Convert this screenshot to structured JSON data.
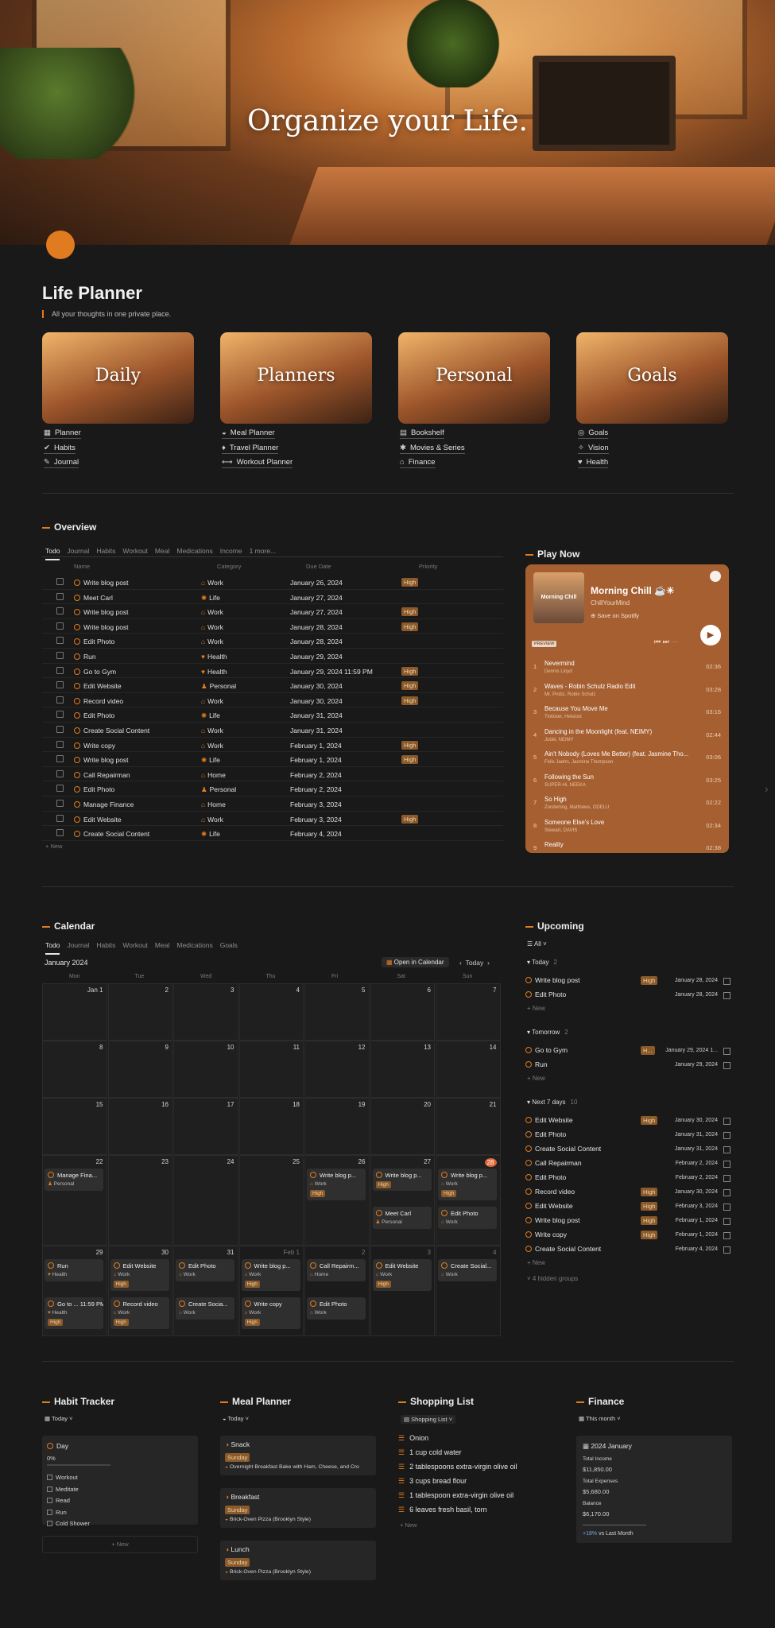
{
  "hero": {
    "title": "Organize your Life."
  },
  "page": {
    "title": "Life Planner",
    "quote": "All your thoughts in one private place."
  },
  "cards": [
    {
      "label": "Daily",
      "links": [
        {
          "icon": "calendar-icon",
          "glyph": "▦",
          "label": "Planner"
        },
        {
          "icon": "check-circle-icon",
          "glyph": "✔",
          "label": "Habits"
        },
        {
          "icon": "pen-icon",
          "glyph": "✎",
          "label": "Journal"
        }
      ]
    },
    {
      "label": "Planners",
      "links": [
        {
          "icon": "bowl-icon",
          "glyph": "◒",
          "label": "Meal Planner"
        },
        {
          "icon": "pin-icon",
          "glyph": "♦",
          "label": "Travel Planner"
        },
        {
          "icon": "dumbbell-icon",
          "glyph": "⟷",
          "label": "Workout Planner"
        }
      ]
    },
    {
      "label": "Personal",
      "links": [
        {
          "icon": "book-icon",
          "glyph": "▤",
          "label": "Bookshelf"
        },
        {
          "icon": "film-icon",
          "glyph": "✱",
          "label": "Movies & Series"
        },
        {
          "icon": "bank-icon",
          "glyph": "⌂",
          "label": "Finance"
        }
      ]
    },
    {
      "label": "Goals",
      "links": [
        {
          "icon": "target-icon",
          "glyph": "◎",
          "label": "Goals"
        },
        {
          "icon": "sparkle-icon",
          "glyph": "✧",
          "label": "Vision"
        },
        {
          "icon": "heart-icon",
          "glyph": "♥",
          "label": "Health"
        }
      ]
    }
  ],
  "overview": {
    "title": "Overview",
    "tabs": [
      "Todo",
      "Journal",
      "Habits",
      "Workout",
      "Meal",
      "Medications",
      "Income",
      "1 more..."
    ],
    "columns": [
      "Name",
      "Category",
      "Due Date",
      "Priority"
    ],
    "rows": [
      {
        "name": "Write blog post",
        "category": "Work",
        "due": "January 26, 2024",
        "priority": "High"
      },
      {
        "name": "Meet Carl",
        "category": "Life",
        "due": "January 27, 2024",
        "priority": ""
      },
      {
        "name": "Write blog post",
        "category": "Work",
        "due": "January 27, 2024",
        "priority": "High"
      },
      {
        "name": "Write blog post",
        "category": "Work",
        "due": "January 28, 2024",
        "priority": "High"
      },
      {
        "name": "Edit Photo",
        "category": "Work",
        "due": "January 28, 2024",
        "priority": ""
      },
      {
        "name": "Run",
        "category": "Health",
        "due": "January 29, 2024",
        "priority": ""
      },
      {
        "name": "Go to Gym",
        "category": "Health",
        "due": "January 29, 2024 11:59 PM",
        "priority": "High"
      },
      {
        "name": "Edit Website",
        "category": "Personal",
        "due": "January 30, 2024",
        "priority": "High"
      },
      {
        "name": "Record video",
        "category": "Work",
        "due": "January 30, 2024",
        "priority": "High"
      },
      {
        "name": "Edit Photo",
        "category": "Life",
        "due": "January 31, 2024",
        "priority": ""
      },
      {
        "name": "Create Social Content",
        "category": "Work",
        "due": "January 31, 2024",
        "priority": ""
      },
      {
        "name": "Write copy",
        "category": "Work",
        "due": "February 1, 2024",
        "priority": "High"
      },
      {
        "name": "Write blog post",
        "category": "Life",
        "due": "February 1, 2024",
        "priority": "High"
      },
      {
        "name": "Call Repairman",
        "category": "Home",
        "due": "February 2, 2024",
        "priority": ""
      },
      {
        "name": "Edit Photo",
        "category": "Personal",
        "due": "February 2, 2024",
        "priority": ""
      },
      {
        "name": "Manage Finance",
        "category": "Home",
        "due": "February 3, 2024",
        "priority": ""
      },
      {
        "name": "Edit Website",
        "category": "Work",
        "due": "February 3, 2024",
        "priority": "High"
      },
      {
        "name": "Create Social Content",
        "category": "Life",
        "due": "February 4, 2024",
        "priority": ""
      }
    ],
    "new_label": "New"
  },
  "play": {
    "title": "Play Now",
    "album": "Morning Chill",
    "playlist": "Morning Chill ☕☀",
    "owner": "ChillYourMind",
    "save": "Save on Spotify",
    "preview": "PREVIEW",
    "tracks": [
      {
        "n": "1",
        "title": "Nevermind",
        "artist": "Dennis Lloyd",
        "dur": "02:36"
      },
      {
        "n": "2",
        "title": "Waves - Robin Schulz Radio Edit",
        "artist": "Mr. Probz, Robin Schulz",
        "dur": "03:28"
      },
      {
        "n": "3",
        "title": "Because You Move Me",
        "artist": "Tinlicker, Helsloot",
        "dur": "03:16"
      },
      {
        "n": "4",
        "title": "Dancing in the Moonlight (feat. NEIMY)",
        "artist": "Jubël, NEIMY",
        "dur": "02:44"
      },
      {
        "n": "5",
        "title": "Ain't Nobody (Loves Me Better) (feat. Jasmine Tho...",
        "artist": "Felix Jaehn, Jasmine Thompson",
        "dur": "03:06"
      },
      {
        "n": "6",
        "title": "Following the Sun",
        "artist": "SUPER-Hi, NEEKA",
        "dur": "03:25"
      },
      {
        "n": "7",
        "title": "So High",
        "artist": "Zonderling, Matthews, ODELU",
        "dur": "02:22"
      },
      {
        "n": "8",
        "title": "Someone Else's Love",
        "artist": "Stewart, DAVIS",
        "dur": "02:34"
      },
      {
        "n": "9",
        "title": "Reality",
        "artist": "",
        "dur": "02:38"
      }
    ]
  },
  "calendar": {
    "title": "Calendar",
    "tabs": [
      "Todo",
      "Journal",
      "Habits",
      "Workout",
      "Meal",
      "Medications",
      "Goals"
    ],
    "month": "January 2024",
    "open": "Open in Calendar",
    "today": "Today",
    "weekdays": [
      "Mon",
      "Tue",
      "Wed",
      "Thu",
      "Fri",
      "Sat",
      "Sun"
    ],
    "days": [
      "Jan 1",
      "2",
      "3",
      "4",
      "5",
      "6",
      "7",
      "8",
      "9",
      "10",
      "11",
      "12",
      "13",
      "14",
      "15",
      "16",
      "17",
      "18",
      "19",
      "20",
      "21",
      "22",
      "23",
      "24",
      "25",
      "26",
      "27",
      "28",
      "29",
      "30",
      "31",
      "Feb 1",
      "2",
      "3",
      "4"
    ],
    "events": [
      {
        "cell": 21,
        "slot": 0,
        "title": "Manage Fina...",
        "tag": "Personal",
        "pill": ""
      },
      {
        "cell": 25,
        "slot": 0,
        "title": "Write blog p...",
        "tag": "Work",
        "pill": "High"
      },
      {
        "cell": 26,
        "slot": 0,
        "title": "Write blog p...",
        "tag": "",
        "pill": "High"
      },
      {
        "cell": 26,
        "slot": 1,
        "title": "Meet Carl",
        "tag": "Personal",
        "pill": ""
      },
      {
        "cell": 27,
        "slot": 0,
        "title": "Write blog p...",
        "tag": "Work",
        "pill": "High"
      },
      {
        "cell": 27,
        "slot": 1,
        "title": "Edit Photo",
        "tag": "Work",
        "pill": ""
      },
      {
        "cell": 28,
        "slot": 0,
        "title": "Run",
        "tag": "Health",
        "pill": ""
      },
      {
        "cell": 28,
        "slot": 1,
        "title": "Go to ...  11:59 PM",
        "tag": "Health",
        "pill": "High"
      },
      {
        "cell": 29,
        "slot": 0,
        "title": "Edit Website",
        "tag": "Work",
        "pill": "High"
      },
      {
        "cell": 29,
        "slot": 1,
        "title": "Record video",
        "tag": "Work",
        "pill": "High"
      },
      {
        "cell": 30,
        "slot": 0,
        "title": "Edit Photo",
        "tag": "Work",
        "pill": ""
      },
      {
        "cell": 30,
        "slot": 1,
        "title": "Create Socia...",
        "tag": "Work",
        "pill": ""
      },
      {
        "cell": 31,
        "slot": 0,
        "title": "Write blog p...",
        "tag": "Work",
        "pill": "High"
      },
      {
        "cell": 31,
        "slot": 1,
        "title": "Write copy",
        "tag": "Work",
        "pill": "High"
      },
      {
        "cell": 32,
        "slot": 0,
        "title": "Call Repairm...",
        "tag": "Home",
        "pill": ""
      },
      {
        "cell": 32,
        "slot": 1,
        "title": "Edit Photo",
        "tag": "Work",
        "pill": ""
      },
      {
        "cell": 33,
        "slot": 0,
        "title": "Edit Website",
        "tag": "Work",
        "pill": "High"
      },
      {
        "cell": 34,
        "slot": 0,
        "title": "Create Social...",
        "tag": "Work",
        "pill": ""
      }
    ]
  },
  "upcoming": {
    "title": "Upcoming",
    "filter": "All",
    "hidden": "4 hidden groups",
    "new_label": "New",
    "groups": [
      {
        "name": "Today",
        "count": "2",
        "items": [
          {
            "t": "Write blog post",
            "p": "High",
            "d": "January 28, 2024"
          },
          {
            "t": "Edit Photo",
            "p": "",
            "d": "January 28, 2024"
          }
        ]
      },
      {
        "name": "Tomorrow",
        "count": "2",
        "items": [
          {
            "t": "Go to Gym",
            "p": "H...",
            "d": "January 29, 2024 1..."
          },
          {
            "t": "Run",
            "p": "",
            "d": "January 29, 2024"
          }
        ]
      },
      {
        "name": "Next 7 days",
        "count": "10",
        "items": [
          {
            "t": "Edit Website",
            "p": "High",
            "d": "January 30, 2024"
          },
          {
            "t": "Edit Photo",
            "p": "",
            "d": "January 31, 2024"
          },
          {
            "t": "Create Social Content",
            "p": "",
            "d": "January 31, 2024"
          },
          {
            "t": "Call Repairman",
            "p": "",
            "d": "February 2, 2024"
          },
          {
            "t": "Edit Photo",
            "p": "",
            "d": "February 2, 2024"
          },
          {
            "t": "Record video",
            "p": "High",
            "d": "January 30, 2024"
          },
          {
            "t": "Edit Website",
            "p": "High",
            "d": "February 3, 2024"
          },
          {
            "t": "Write blog post",
            "p": "High",
            "d": "February 1, 2024"
          },
          {
            "t": "Write copy",
            "p": "High",
            "d": "February 1, 2024"
          },
          {
            "t": "Create Social Content",
            "p": "",
            "d": "February 4, 2024"
          }
        ]
      }
    ]
  },
  "habit": {
    "title": "Habit Tracker",
    "view": "Today",
    "day": "Day",
    "pct": "0%",
    "items": [
      "Workout",
      "Meditate",
      "Read",
      "Run",
      "Cold Shower"
    ],
    "new": "New"
  },
  "meal": {
    "title": "Meal Planner",
    "view": "Today",
    "meals": [
      {
        "name": "Snack",
        "day": "Sunday",
        "dish": "Overnight Breakfast Bake with Ham, Cheese, and Cro"
      },
      {
        "name": "Breakfast",
        "day": "Sunday",
        "dish": "Brick-Oven Pizza (Brooklyn Style)"
      },
      {
        "name": "Lunch",
        "day": "Sunday",
        "dish": "Brick-Oven Pizza (Brooklyn Style)"
      }
    ]
  },
  "shopping": {
    "title": "Shopping List",
    "view": "Shopping List",
    "items": [
      "Onion",
      "1 cup cold water",
      "2 tablespoons extra-virgin olive oil",
      "3 cups bread flour",
      "1 tablespoon extra-virgin olive oil",
      "6 leaves fresh basil, torn"
    ],
    "new": "New"
  },
  "finance": {
    "title": "Finance",
    "view": "This month",
    "card": "2024 January",
    "income_label": "Total Income",
    "income": "$11,850.00",
    "exp_label": "Total Expenses",
    "exp": "$5,680.00",
    "bal_label": "Balance",
    "bal": "$6,170.00",
    "delta": "+18%",
    "vs": "vs Last Month"
  },
  "colors": {
    "accent": "#e07b1f",
    "pill": "#8a5a2b",
    "spotify": "#a65f31"
  }
}
